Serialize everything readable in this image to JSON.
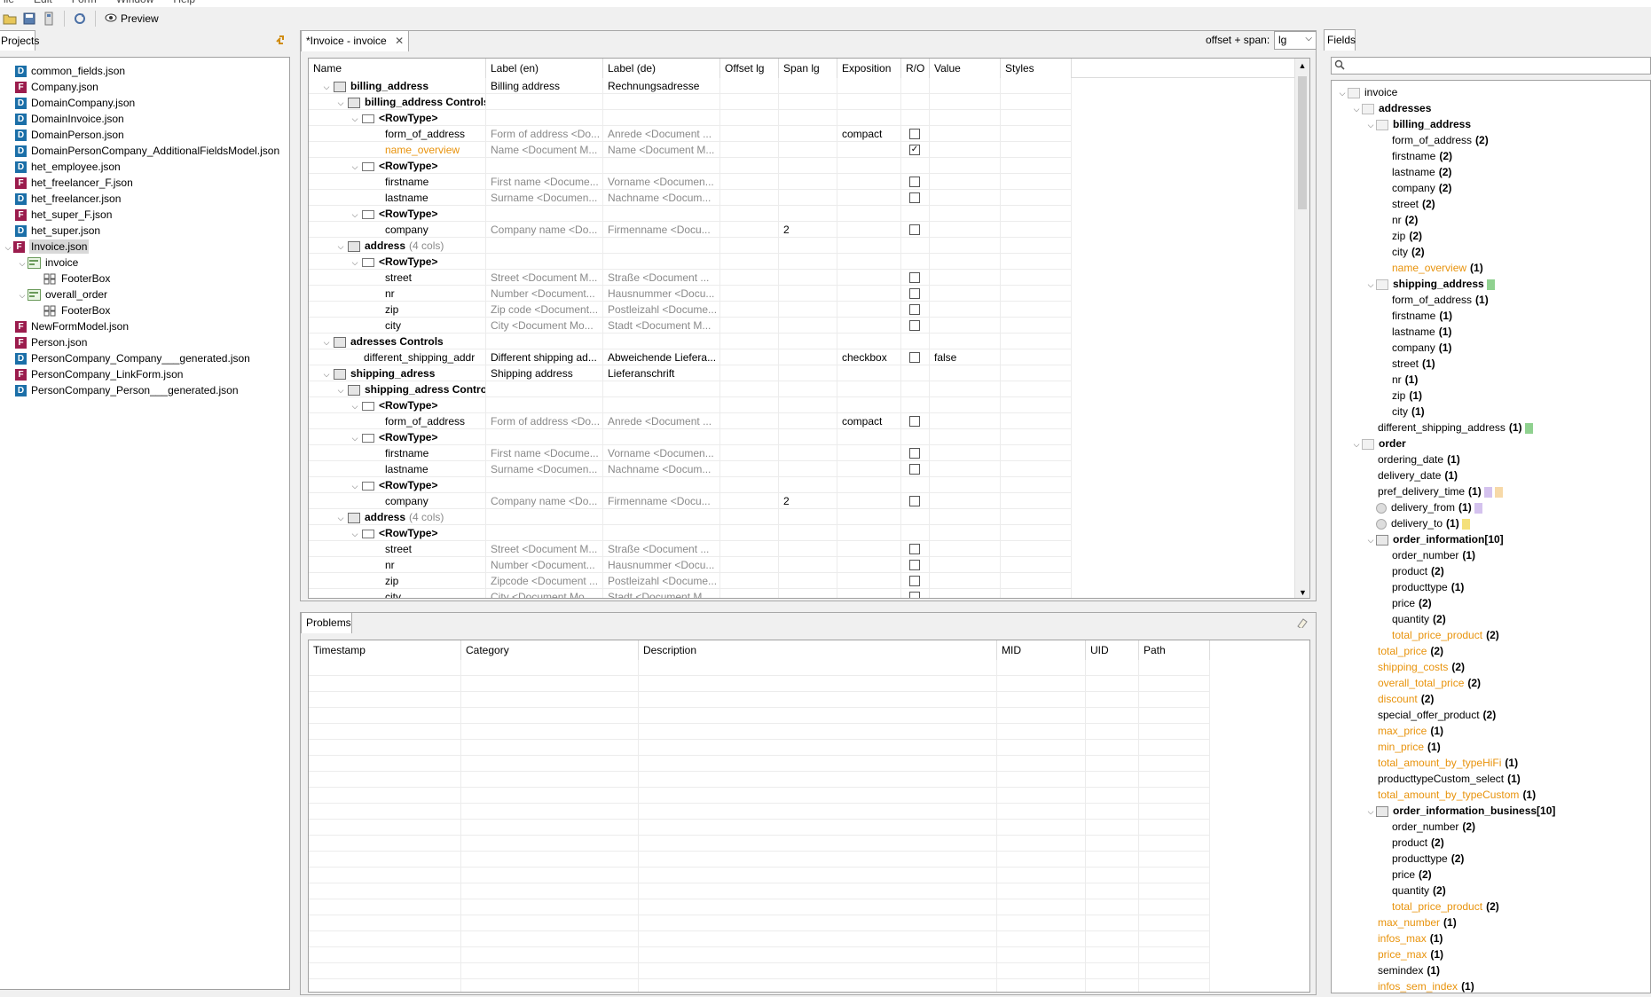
{
  "menu": [
    "ile",
    "Edit",
    "Form",
    "Window",
    "Help"
  ],
  "toolbar": {
    "preview_label": "Preview"
  },
  "projects": {
    "tab_label": "Projects",
    "items": [
      {
        "type": "D",
        "label": "common_fields.json"
      },
      {
        "type": "F",
        "label": "Company.json"
      },
      {
        "type": "D",
        "label": "DomainCompany.json"
      },
      {
        "type": "D",
        "label": "DomainInvoice.json"
      },
      {
        "type": "D",
        "label": "DomainPerson.json"
      },
      {
        "type": "D",
        "label": "DomainPersonCompany_AdditionalFieldsModel.json"
      },
      {
        "type": "D",
        "label": "het_employee.json"
      },
      {
        "type": "F",
        "label": "het_freelancer_F.json"
      },
      {
        "type": "D",
        "label": "het_freelancer.json"
      },
      {
        "type": "F",
        "label": "het_super_F.json"
      },
      {
        "type": "D",
        "label": "het_super.json"
      },
      {
        "type": "F",
        "label": "Invoice.json"
      },
      {
        "type": "form",
        "label": "invoice"
      },
      {
        "type": "footer",
        "label": "FooterBox"
      },
      {
        "type": "form",
        "label": "overall_order"
      },
      {
        "type": "footer",
        "label": "FooterBox"
      },
      {
        "type": "F",
        "label": "NewFormModel.json"
      },
      {
        "type": "F",
        "label": "Person.json"
      },
      {
        "type": "D",
        "label": "PersonCompany_Company___generated.json"
      },
      {
        "type": "F",
        "label": "PersonCompany_LinkForm.json"
      },
      {
        "type": "D",
        "label": "PersonCompany_Person___generated.json"
      }
    ]
  },
  "editor": {
    "tab_label": "*Invoice - invoice",
    "offset_label": "offset + span:",
    "offset_value": "lg",
    "columns": [
      "Name",
      "Label (en)",
      "Label (de)",
      "Offset lg",
      "Span lg",
      "Exposition",
      "R/O",
      "Value",
      "Styles"
    ],
    "rows": [
      {
        "name": "billing_address",
        "en": "Billing address",
        "de": "Rechnungsadresse",
        "off": "",
        "span": "",
        "exp": "",
        "ro": "",
        "val": ""
      },
      {
        "name": "billing_address Controls",
        "en": "",
        "de": "",
        "off": "",
        "span": "",
        "exp": "",
        "ro": "",
        "val": ""
      },
      {
        "name": "<RowType>",
        "en": "",
        "de": "",
        "off": "",
        "span": "",
        "exp": "",
        "ro": "",
        "val": ""
      },
      {
        "name": "form_of_address",
        "en": "Form of address <Do...",
        "de": "Anrede <Document ...",
        "off": "",
        "span": "",
        "exp": "compact",
        "ro": "unchecked",
        "val": ""
      },
      {
        "name": "name_overview",
        "en": "Name <Document M...",
        "de": "Name <Document M...",
        "off": "",
        "span": "",
        "exp": "",
        "ro": "checked",
        "val": ""
      },
      {
        "name": "<RowType>",
        "en": "",
        "de": "",
        "off": "",
        "span": "",
        "exp": "",
        "ro": "",
        "val": ""
      },
      {
        "name": "firstname",
        "en": "First name <Docume...",
        "de": "Vorname <Documen...",
        "off": "",
        "span": "",
        "exp": "",
        "ro": "unchecked",
        "val": ""
      },
      {
        "name": "lastname",
        "en": "Surname <Documen...",
        "de": "Nachname <Docum...",
        "off": "",
        "span": "",
        "exp": "",
        "ro": "unchecked",
        "val": ""
      },
      {
        "name": "<RowType>",
        "en": "",
        "de": "",
        "off": "",
        "span": "",
        "exp": "",
        "ro": "",
        "val": ""
      },
      {
        "name": "company",
        "en": "Company name <Do...",
        "de": "Firmenname <Docu...",
        "off": "",
        "span": "2",
        "exp": "",
        "ro": "unchecked",
        "val": ""
      },
      {
        "name": "address",
        "extra": "(4 cols)",
        "en": "",
        "de": "",
        "off": "",
        "span": "",
        "exp": "",
        "ro": "",
        "val": ""
      },
      {
        "name": "<RowType>",
        "en": "",
        "de": "",
        "off": "",
        "span": "",
        "exp": "",
        "ro": "",
        "val": ""
      },
      {
        "name": "street",
        "en": "Street <Document M...",
        "de": "Straße <Document ...",
        "off": "",
        "span": "",
        "exp": "",
        "ro": "unchecked",
        "val": ""
      },
      {
        "name": "nr",
        "en": "Number <Document...",
        "de": "Hausnummer <Docu...",
        "off": "",
        "span": "",
        "exp": "",
        "ro": "unchecked",
        "val": ""
      },
      {
        "name": "zip",
        "en": "Zip code <Document...",
        "de": "Postleizahl <Docume...",
        "off": "",
        "span": "",
        "exp": "",
        "ro": "unchecked",
        "val": ""
      },
      {
        "name": "city",
        "en": "City <Document Mo...",
        "de": "Stadt <Document M...",
        "off": "",
        "span": "",
        "exp": "",
        "ro": "unchecked",
        "val": ""
      },
      {
        "name": "adresses Controls",
        "en": "",
        "de": "",
        "off": "",
        "span": "",
        "exp": "",
        "ro": "",
        "val": ""
      },
      {
        "name": "different_shipping_addr",
        "en": "Different shipping ad...",
        "de": "Abweichende Liefera...",
        "off": "",
        "span": "",
        "exp": "checkbox",
        "ro": "unchecked",
        "val": "false"
      },
      {
        "name": "shipping_adress",
        "en": "Shipping address",
        "de": "Lieferanschrift",
        "off": "",
        "span": "",
        "exp": "",
        "ro": "",
        "val": ""
      },
      {
        "name": "shipping_adress Controls",
        "en": "",
        "de": "",
        "off": "",
        "span": "",
        "exp": "",
        "ro": "",
        "val": ""
      },
      {
        "name": "<RowType>",
        "en": "",
        "de": "",
        "off": "",
        "span": "",
        "exp": "",
        "ro": "",
        "val": ""
      },
      {
        "name": "form_of_address",
        "en": "Form of address <Do...",
        "de": "Anrede <Document ...",
        "off": "",
        "span": "",
        "exp": "compact",
        "ro": "unchecked",
        "val": ""
      },
      {
        "name": "<RowType>",
        "en": "",
        "de": "",
        "off": "",
        "span": "",
        "exp": "",
        "ro": "",
        "val": ""
      },
      {
        "name": "firstname",
        "en": "First name <Docume...",
        "de": "Vorname <Documen...",
        "off": "",
        "span": "",
        "exp": "",
        "ro": "unchecked",
        "val": ""
      },
      {
        "name": "lastname",
        "en": "Surname <Documen...",
        "de": "Nachname <Docum...",
        "off": "",
        "span": "",
        "exp": "",
        "ro": "unchecked",
        "val": ""
      },
      {
        "name": "<RowType>",
        "en": "",
        "de": "",
        "off": "",
        "span": "",
        "exp": "",
        "ro": "",
        "val": ""
      },
      {
        "name": "company",
        "en": "Company name <Do...",
        "de": "Firmenname <Docu...",
        "off": "",
        "span": "2",
        "exp": "",
        "ro": "unchecked",
        "val": ""
      },
      {
        "name": "address",
        "extra": "(4 cols)",
        "en": "",
        "de": "",
        "off": "",
        "span": "",
        "exp": "",
        "ro": "",
        "val": ""
      },
      {
        "name": "<RowType>",
        "en": "",
        "de": "",
        "off": "",
        "span": "",
        "exp": "",
        "ro": "",
        "val": ""
      },
      {
        "name": "street",
        "en": "Street <Document M...",
        "de": "Straße <Document ...",
        "off": "",
        "span": "",
        "exp": "",
        "ro": "unchecked",
        "val": ""
      },
      {
        "name": "nr",
        "en": "Number <Document...",
        "de": "Hausnummer <Docu...",
        "off": "",
        "span": "",
        "exp": "",
        "ro": "unchecked",
        "val": ""
      },
      {
        "name": "zip",
        "en": "Zipcode <Document ...",
        "de": "Postleizahl <Docume...",
        "off": "",
        "span": "",
        "exp": "",
        "ro": "unchecked",
        "val": ""
      },
      {
        "name": "city",
        "en": "City <Document Mo...",
        "de": "Stadt <Document M...",
        "off": "",
        "span": "",
        "exp": "",
        "ro": "unchecked",
        "val": ""
      }
    ]
  },
  "problems": {
    "tab_label": "Problems",
    "columns": [
      "Timestamp",
      "Category",
      "Description",
      "MID",
      "UID",
      "Path"
    ]
  },
  "fields": {
    "tab_label": "Fields",
    "items": [
      {
        "label": "invoice",
        "count": ""
      },
      {
        "label": "addresses",
        "count": ""
      },
      {
        "label": "billing_address",
        "count": ""
      },
      {
        "label": "form_of_address",
        "count": "(2)"
      },
      {
        "label": "firstname",
        "count": "(2)"
      },
      {
        "label": "lastname",
        "count": "(2)"
      },
      {
        "label": "company",
        "count": "(2)"
      },
      {
        "label": "street",
        "count": "(2)"
      },
      {
        "label": "nr",
        "count": "(2)"
      },
      {
        "label": "zip",
        "count": "(2)"
      },
      {
        "label": "city",
        "count": "(2)"
      },
      {
        "label": "name_overview",
        "count": "(1)"
      },
      {
        "label": "shipping_address",
        "count": ""
      },
      {
        "label": "form_of_address",
        "count": "(1)"
      },
      {
        "label": "firstname",
        "count": "(1)"
      },
      {
        "label": "lastname",
        "count": "(1)"
      },
      {
        "label": "company",
        "count": "(1)"
      },
      {
        "label": "street",
        "count": "(1)"
      },
      {
        "label": "nr",
        "count": "(1)"
      },
      {
        "label": "zip",
        "count": "(1)"
      },
      {
        "label": "city",
        "count": "(1)"
      },
      {
        "label": "different_shipping_address",
        "count": "(1)"
      },
      {
        "label": "order",
        "count": ""
      },
      {
        "label": "ordering_date",
        "count": "(1)"
      },
      {
        "label": "delivery_date",
        "count": "(1)"
      },
      {
        "label": "pref_delivery_time",
        "count": "(1)"
      },
      {
        "label": "delivery_from",
        "count": "(1)"
      },
      {
        "label": "delivery_to",
        "count": "(1)"
      },
      {
        "label": "order_information[10]",
        "count": ""
      },
      {
        "label": "order_number",
        "count": "(1)"
      },
      {
        "label": "product",
        "count": "(2)"
      },
      {
        "label": "producttype",
        "count": "(1)"
      },
      {
        "label": "price",
        "count": "(2)"
      },
      {
        "label": "quantity",
        "count": "(2)"
      },
      {
        "label": "total_price_product",
        "count": "(2)"
      },
      {
        "label": "total_price",
        "count": "(2)"
      },
      {
        "label": "shipping_costs",
        "count": "(2)"
      },
      {
        "label": "overall_total_price",
        "count": "(2)"
      },
      {
        "label": "discount",
        "count": "(2)"
      },
      {
        "label": "special_offer_product",
        "count": "(2)"
      },
      {
        "label": "max_price",
        "count": "(1)"
      },
      {
        "label": "min_price",
        "count": "(1)"
      },
      {
        "label": "total_amount_by_typeHiFi",
        "count": "(1)"
      },
      {
        "label": "producttypeCustom_select",
        "count": "(1)"
      },
      {
        "label": "total_amount_by_typeCustom",
        "count": "(1)"
      },
      {
        "label": "order_information_business[10]",
        "count": ""
      },
      {
        "label": "order_number",
        "count": "(2)"
      },
      {
        "label": "product",
        "count": "(2)"
      },
      {
        "label": "producttype",
        "count": "(2)"
      },
      {
        "label": "price",
        "count": "(2)"
      },
      {
        "label": "quantity",
        "count": "(2)"
      },
      {
        "label": "total_price_product",
        "count": "(2)"
      },
      {
        "label": "max_number",
        "count": "(1)"
      },
      {
        "label": "infos_max",
        "count": "(1)"
      },
      {
        "label": "price_max",
        "count": "(1)"
      },
      {
        "label": "semindex",
        "count": "(1)"
      },
      {
        "label": "infos_sem_index",
        "count": "(1)"
      }
    ]
  },
  "colors": {
    "orange": "#e8930c",
    "green": "#8fd18f",
    "lavender": "#d4c2ee",
    "peach": "#f7d9a8",
    "yellow": "#f4e07a"
  }
}
